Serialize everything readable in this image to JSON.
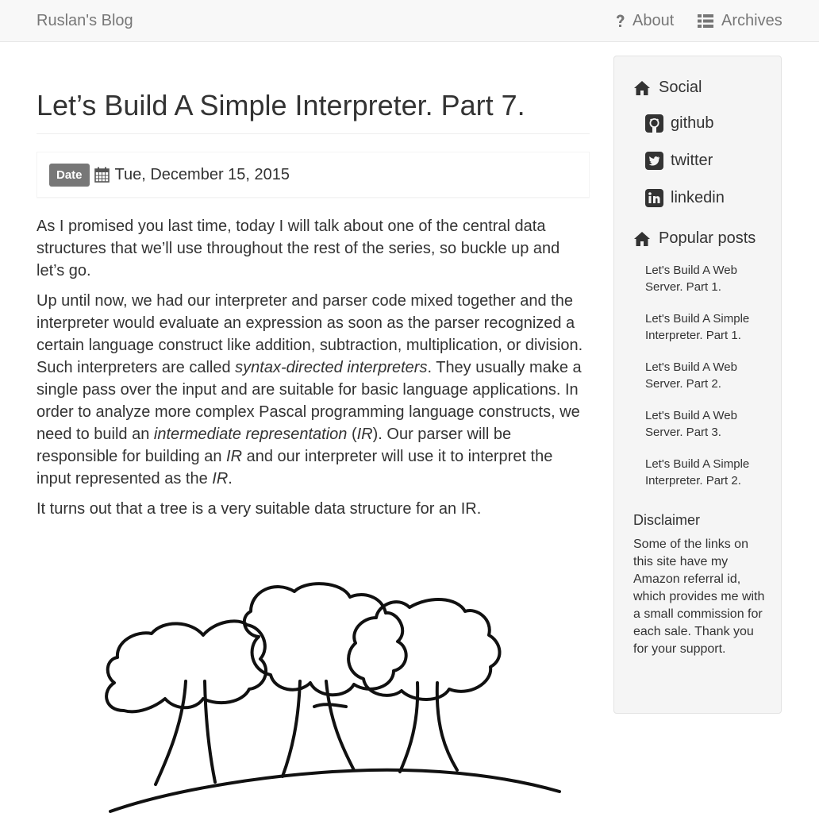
{
  "nav": {
    "brand": "Ruslan's Blog",
    "about": "About",
    "archives": "Archives"
  },
  "post": {
    "title": "Let’s Build A Simple Interpreter. Part 7.",
    "date_label": "Date",
    "date": "Tue, December 15, 2015",
    "p1": "As I promised you last time, today I will talk about one of the central data structures that we’ll use throughout the rest of the series, so buckle up and let’s go.",
    "p2": {
      "a": "Up until now, we had our interpreter and parser code mixed together and the interpreter would evaluate an expression as soon as the parser recognized a certain language construct like addition, subtraction, multiplication, or division. Such interpreters are called ",
      "b": "syntax-directed interpreters",
      "c": ". They usually make a single pass over the input and are suitable for basic language applications. In order to analyze more complex Pascal programming language constructs, we need to build an ",
      "d": "intermediate representation",
      "e": " (",
      "f": "IR",
      "g": "). Our parser will be responsible for building an ",
      "h": "IR",
      "i": " and our interpreter will use it to interpret the input represented as the ",
      "j": "IR",
      "k": "."
    },
    "p3": "It turns out that a tree is a very suitable data structure for an  IR."
  },
  "sidebar": {
    "social_title": "Social",
    "social": [
      {
        "label": "github",
        "icon": "github-icon"
      },
      {
        "label": "twitter",
        "icon": "twitter-icon"
      },
      {
        "label": "linkedin",
        "icon": "linkedin-icon"
      }
    ],
    "popular_title": "Popular posts",
    "popular": [
      "Let's Build A Web Server. Part 1.",
      "Let's Build A Simple Interpreter. Part 1.",
      "Let's Build A Web Server. Part 2.",
      "Let's Build A Web Server. Part 3.",
      "Let's Build A Simple Interpreter. Part 2."
    ],
    "disclaimer_title": "Disclaimer",
    "disclaimer_text": "Some of the links on this site have my Amazon referral id, which provides me with a small commission for each sale. Thank you for your support."
  }
}
